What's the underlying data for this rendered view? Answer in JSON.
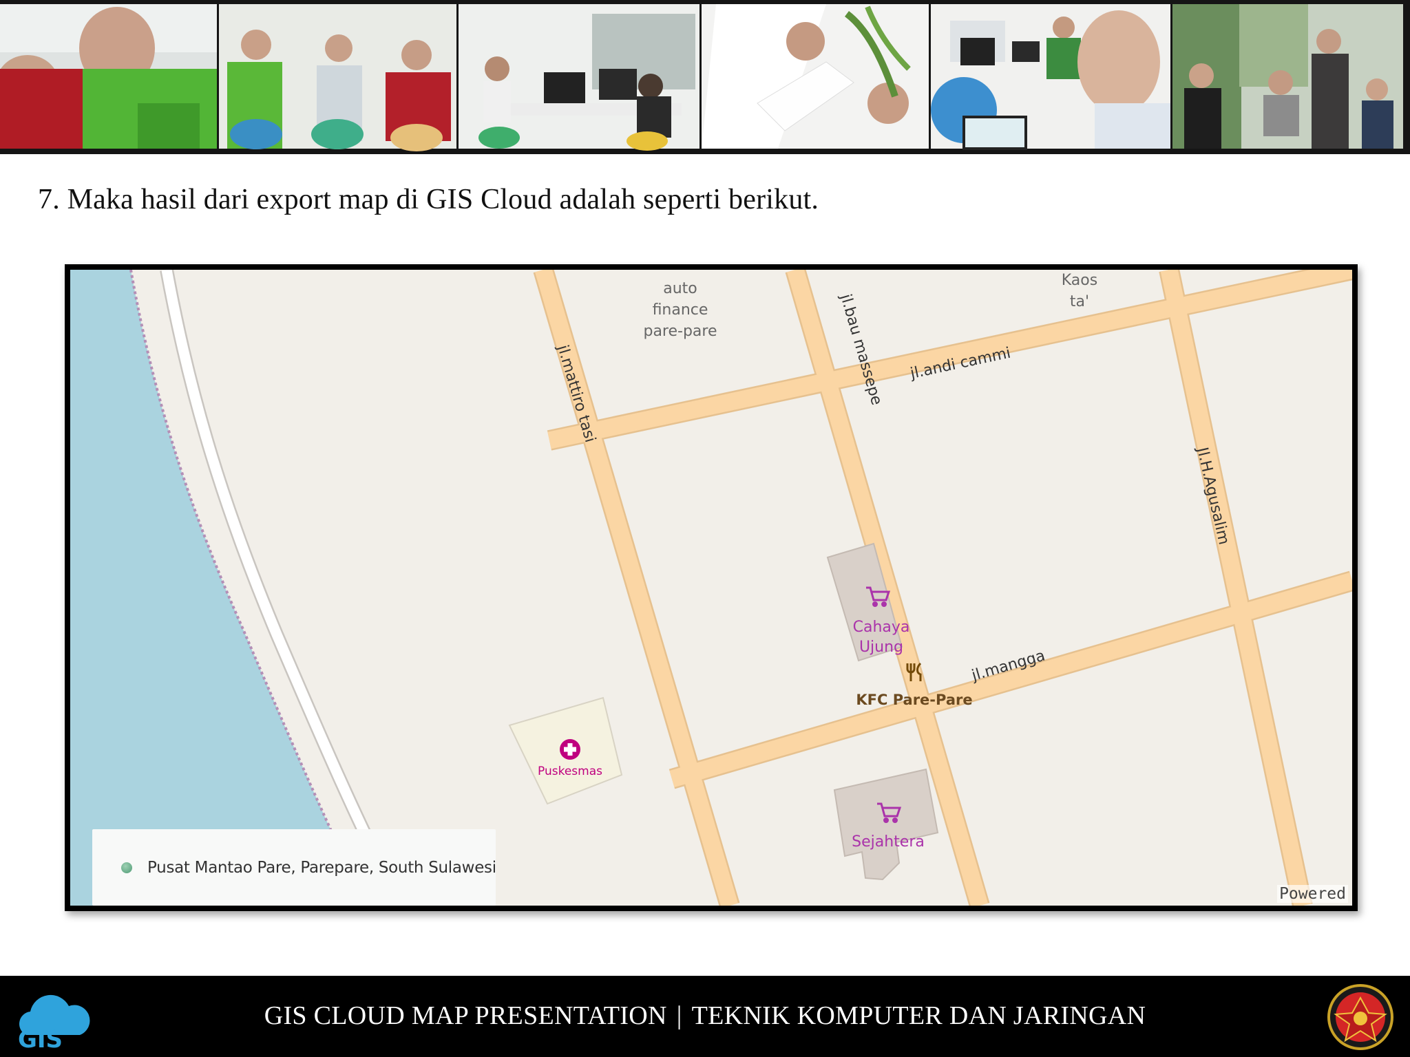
{
  "header": {
    "photo_strip": "team-photo-collage"
  },
  "slide": {
    "text": "7. Maka hasil dari export map di GIS Cloud adalah seperti berikut."
  },
  "map": {
    "street_labels": {
      "mattiro_tasi": "jl.mattiro tasi",
      "bau_massepe": "jl.bau massepe",
      "andi_cammi": "jl.andi cammi",
      "mangga": "jl.mangga",
      "agusalim": "Jl.H.Agusalim"
    },
    "place_labels": {
      "finance_line1": "auto",
      "finance_line2": "finance",
      "finance_line3": "pare-pare",
      "kaos_line1": "Kaos",
      "kaos_line2": "ta'",
      "cahaya_line1": "Cahaya",
      "cahaya_line2": "Ujung",
      "kfc": "KFC Pare-Pare",
      "puskesmas": "Puskesmas",
      "sejahtera": "Sejahtera"
    },
    "location_card": {
      "text": "Pusat Mantao Pare, Parepare, South Sulawesi"
    },
    "attribution": "Powered",
    "colors": {
      "water": "#aad3df",
      "land": "#f2efe9",
      "road": "#fbd6a4",
      "road_casing": "#e8bb82",
      "shop_building": "#d9d0c9",
      "poi_purple": "#aa33aa",
      "hospital": "#bf007f",
      "restaurant": "#734a08"
    }
  },
  "footer": {
    "logo": "GIS",
    "text_left": "GIS CLOUD MAP PRESENTATION",
    "separator": "|",
    "text_right": "TEKNIK KOMPUTER DAN JARINGAN"
  }
}
